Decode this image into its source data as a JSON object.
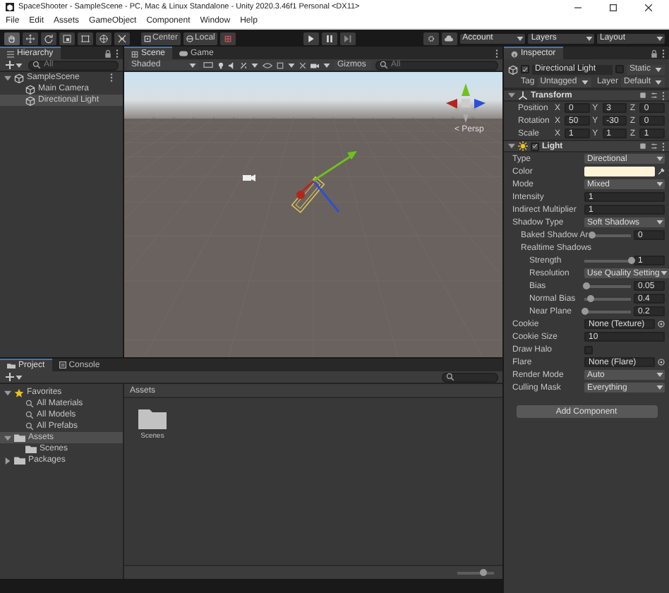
{
  "window": {
    "title": "SpaceShooter - SampleScene - PC, Mac & Linux Standalone - Unity 2020.3.46f1 Personal <DX11>"
  },
  "menu": [
    "File",
    "Edit",
    "Assets",
    "GameObject",
    "Component",
    "Window",
    "Help"
  ],
  "toolbar": {
    "tools": [
      {
        "kind": "hand",
        "selected": true
      },
      {
        "kind": "move",
        "selected": false
      },
      {
        "kind": "rotate",
        "selected": false
      },
      {
        "kind": "scale",
        "selected": false
      },
      {
        "kind": "rect",
        "selected": false
      },
      {
        "kind": "transform",
        "selected": false
      },
      {
        "kind": "custom",
        "selected": false
      }
    ],
    "pivot": "Center",
    "space": "Local",
    "account": "Account",
    "layers": "Layers",
    "layout": "Layout"
  },
  "hierarchy": {
    "title": "Hierarchy",
    "search_placeholder": "All",
    "tree": [
      {
        "label": "SampleScene",
        "kind": "scene",
        "expanded": true,
        "selected": false,
        "children": [
          {
            "label": "Main Camera",
            "kind": "object",
            "selected": false
          },
          {
            "label": "Directional Light",
            "kind": "object",
            "selected": true
          }
        ]
      }
    ]
  },
  "scene": {
    "tabs": [
      {
        "label": "Scene",
        "selected": true
      },
      {
        "label": "Game",
        "selected": false
      }
    ],
    "shading": "Shaded",
    "gizmos": "Gizmos",
    "search_placeholder": "All",
    "view_label": "< Persp"
  },
  "inspector": {
    "title": "Inspector",
    "object": {
      "name": "Directional Light",
      "active": true,
      "static": false,
      "static_label": "Static"
    },
    "tag_label": "Tag",
    "tag": "Untagged",
    "layer_label": "Layer",
    "layer": "Default",
    "components": [
      {
        "name": "Transform",
        "kind": "transform",
        "expanded": true,
        "rows": [
          {
            "label": "Position",
            "kind": "vector",
            "values": [
              {
                "axis": "X",
                "value": "0"
              },
              {
                "axis": "Y",
                "value": "3"
              },
              {
                "axis": "Z",
                "value": "0"
              }
            ]
          },
          {
            "label": "Rotation",
            "kind": "vector",
            "values": [
              {
                "axis": "X",
                "value": "50"
              },
              {
                "axis": "Y",
                "value": "-30"
              },
              {
                "axis": "Z",
                "value": "0"
              }
            ]
          },
          {
            "label": "Scale",
            "kind": "vector",
            "values": [
              {
                "axis": "X",
                "value": "1"
              },
              {
                "axis": "Y",
                "value": "1"
              },
              {
                "axis": "Z",
                "value": "1"
              }
            ]
          }
        ]
      },
      {
        "name": "Light",
        "kind": "light",
        "enabled": true,
        "expanded": true,
        "rows": [
          {
            "label": "Type",
            "kind": "dropdown",
            "value": "Directional"
          },
          {
            "label": "Color",
            "kind": "color",
            "color": "#fff4d6"
          },
          {
            "label": "Mode",
            "kind": "dropdown",
            "value": "Mixed"
          },
          {
            "label": "Intensity",
            "kind": "number",
            "value": "1"
          },
          {
            "label": "Indirect Multiplier",
            "kind": "number",
            "value": "1"
          },
          {
            "label": "Shadow Type",
            "kind": "dropdown",
            "value": "Soft Shadows",
            "children": [
              {
                "label": "Baked Shadow Ar",
                "kind": "slider",
                "level": 0,
                "value": "0"
              },
              {
                "label": "Realtime Shadows",
                "kind": "heading",
                "children": [
                  {
                    "label": "Strength",
                    "kind": "slider",
                    "level": 1,
                    "value": "1"
                  },
                  {
                    "label": "Resolution",
                    "kind": "dropdown",
                    "value": "Use Quality Setting"
                  },
                  {
                    "label": "Bias",
                    "kind": "slider",
                    "level": 0.03,
                    "value": "0.05"
                  },
                  {
                    "label": "Normal Bias",
                    "kind": "slider",
                    "level": 0.13,
                    "value": "0.4"
                  },
                  {
                    "label": "Near Plane",
                    "kind": "slider",
                    "level": 0.01,
                    "value": "0.2"
                  }
                ]
              }
            ]
          },
          {
            "label": "Cookie",
            "kind": "object",
            "value": "None (Texture)"
          },
          {
            "label": "Cookie Size",
            "kind": "number",
            "value": "10"
          },
          {
            "label": "Draw Halo",
            "kind": "checkbox",
            "checked": false
          },
          {
            "label": "Flare",
            "kind": "object",
            "value": "None (Flare)"
          },
          {
            "label": "Render Mode",
            "kind": "dropdown",
            "value": "Auto"
          },
          {
            "label": "Culling Mask",
            "kind": "dropdown",
            "value": "Everything"
          }
        ]
      }
    ],
    "add_button": "Add Component"
  },
  "project": {
    "tabs": [
      {
        "label": "Project",
        "selected": true
      },
      {
        "label": "Console",
        "selected": false
      }
    ],
    "tree": [
      {
        "label": "Favorites",
        "kind": "star",
        "expanded": true,
        "selected": false,
        "children": [
          {
            "label": "All Materials",
            "kind": "search",
            "selected": false
          },
          {
            "label": "All Models",
            "kind": "search",
            "selected": false
          },
          {
            "label": "All Prefabs",
            "kind": "search",
            "selected": false
          }
        ]
      },
      {
        "label": "Assets",
        "kind": "folder",
        "expanded": true,
        "selected": true,
        "children": [
          {
            "label": "Scenes",
            "kind": "folder",
            "selected": false
          }
        ]
      },
      {
        "label": "Packages",
        "kind": "folder",
        "expanded": false,
        "selected": false
      }
    ],
    "breadcrumb": "Assets",
    "items": [
      {
        "label": "Scenes",
        "kind": "folder"
      }
    ],
    "icon_size": {
      "level": 0.7
    }
  }
}
